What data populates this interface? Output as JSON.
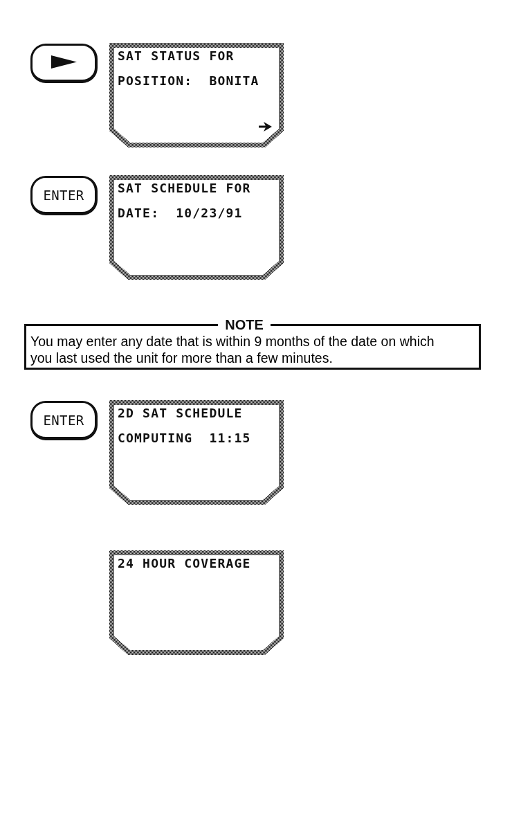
{
  "steps": [
    {
      "kind": "step",
      "key": {
        "kind": "arrow"
      },
      "screen": {
        "lines": [
          "SAT STATUS FOR",
          "POSITION:  BONITA"
        ],
        "more_arrow": true
      }
    },
    {
      "kind": "step",
      "key": {
        "kind": "label",
        "label": "ENTER"
      },
      "screen": {
        "lines": [
          "SAT SCHEDULE FOR",
          "DATE:  10/23/91"
        ],
        "more_arrow": false
      }
    },
    {
      "kind": "note",
      "title": "NOTE",
      "text": "You may enter any date that is within 9 months of the date on which you last used the unit for more than a few minutes."
    },
    {
      "kind": "step",
      "key": {
        "kind": "label",
        "label": "ENTER"
      },
      "screen": {
        "lines": [
          "2D SAT SCHEDULE",
          "COMPUTING  11:15"
        ],
        "more_arrow": false
      }
    },
    {
      "kind": "step",
      "screen": {
        "lines": [
          "24 HOUR COVERAGE"
        ],
        "more_arrow": false
      }
    }
  ]
}
